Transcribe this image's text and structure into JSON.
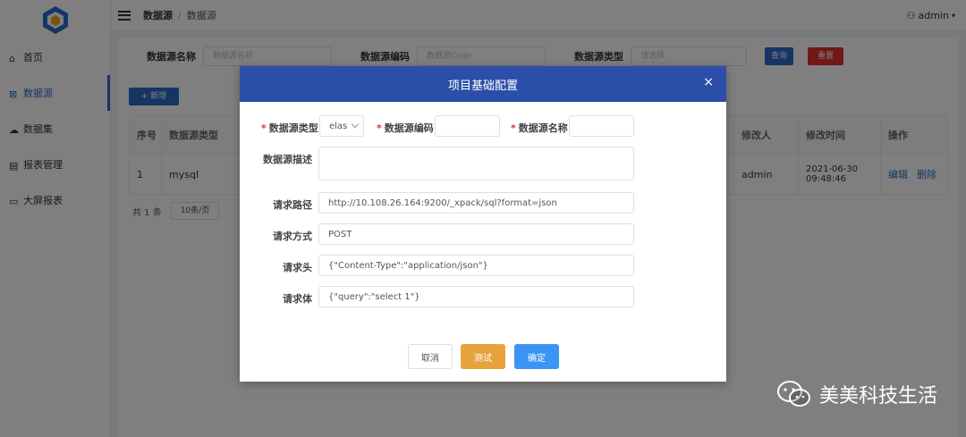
{
  "sidebar": {
    "items": [
      {
        "label": "首页",
        "icon": "home-icon"
      },
      {
        "label": "数据源",
        "icon": "datasource-icon"
      },
      {
        "label": "数据集",
        "icon": "dataset-icon"
      },
      {
        "label": "报表管理",
        "icon": "report-icon"
      },
      {
        "label": "大屏报表",
        "icon": "dashboard-icon"
      }
    ]
  },
  "topbar": {
    "crumb_parent": "数据源",
    "crumb_sep": "/",
    "crumb_current": "数据源",
    "user": "admin"
  },
  "search": {
    "name_label": "数据源名称",
    "name_placeholder": "数据源名称",
    "code_label": "数据源编码",
    "code_placeholder": "数据源Code",
    "type_label": "数据源类型",
    "type_placeholder": "请选择",
    "query_label": "查询",
    "reset_label": "重置",
    "add_label": "+ 新增"
  },
  "table": {
    "headers": [
      "序号",
      "数据源类型",
      "修改人",
      "修改时间",
      "操作"
    ],
    "rows": [
      {
        "index": "1",
        "type": "mysql",
        "modifier": "admin",
        "time": "2021-06-30 09:48:46",
        "edit": "编辑",
        "delete": "删除"
      }
    ]
  },
  "pager": {
    "total": "共 1 条",
    "page_size": "10条/页"
  },
  "modal": {
    "title": "项目基础配置",
    "close": "×",
    "type_label": "数据源类型",
    "type_value": "elas",
    "code_label": "数据源编码",
    "code_value": "",
    "name_label": "数据源名称",
    "name_value": "",
    "desc_label": "数据源描述",
    "desc_value": "",
    "url_label": "请求路径",
    "url_value": "http://10.108.26.164:9200/_xpack/sql?format=json",
    "method_label": "请求方式",
    "method_value": "POST",
    "header_label": "请求头",
    "header_value": "{\"Content-Type\":\"application/json\"}",
    "body_label": "请求体",
    "body_value": "{\"query\":\"select 1\"}",
    "cancel_label": "取消",
    "test_label": "测试",
    "ok_label": "确定"
  },
  "watermark": {
    "text": "美美科技生活"
  },
  "colors": {
    "primary": "#2d6ac9",
    "modal_header": "#2b4fa8",
    "danger": "#e0312b",
    "test_button": "#e8a23b",
    "ok_button": "#3a95f5"
  }
}
